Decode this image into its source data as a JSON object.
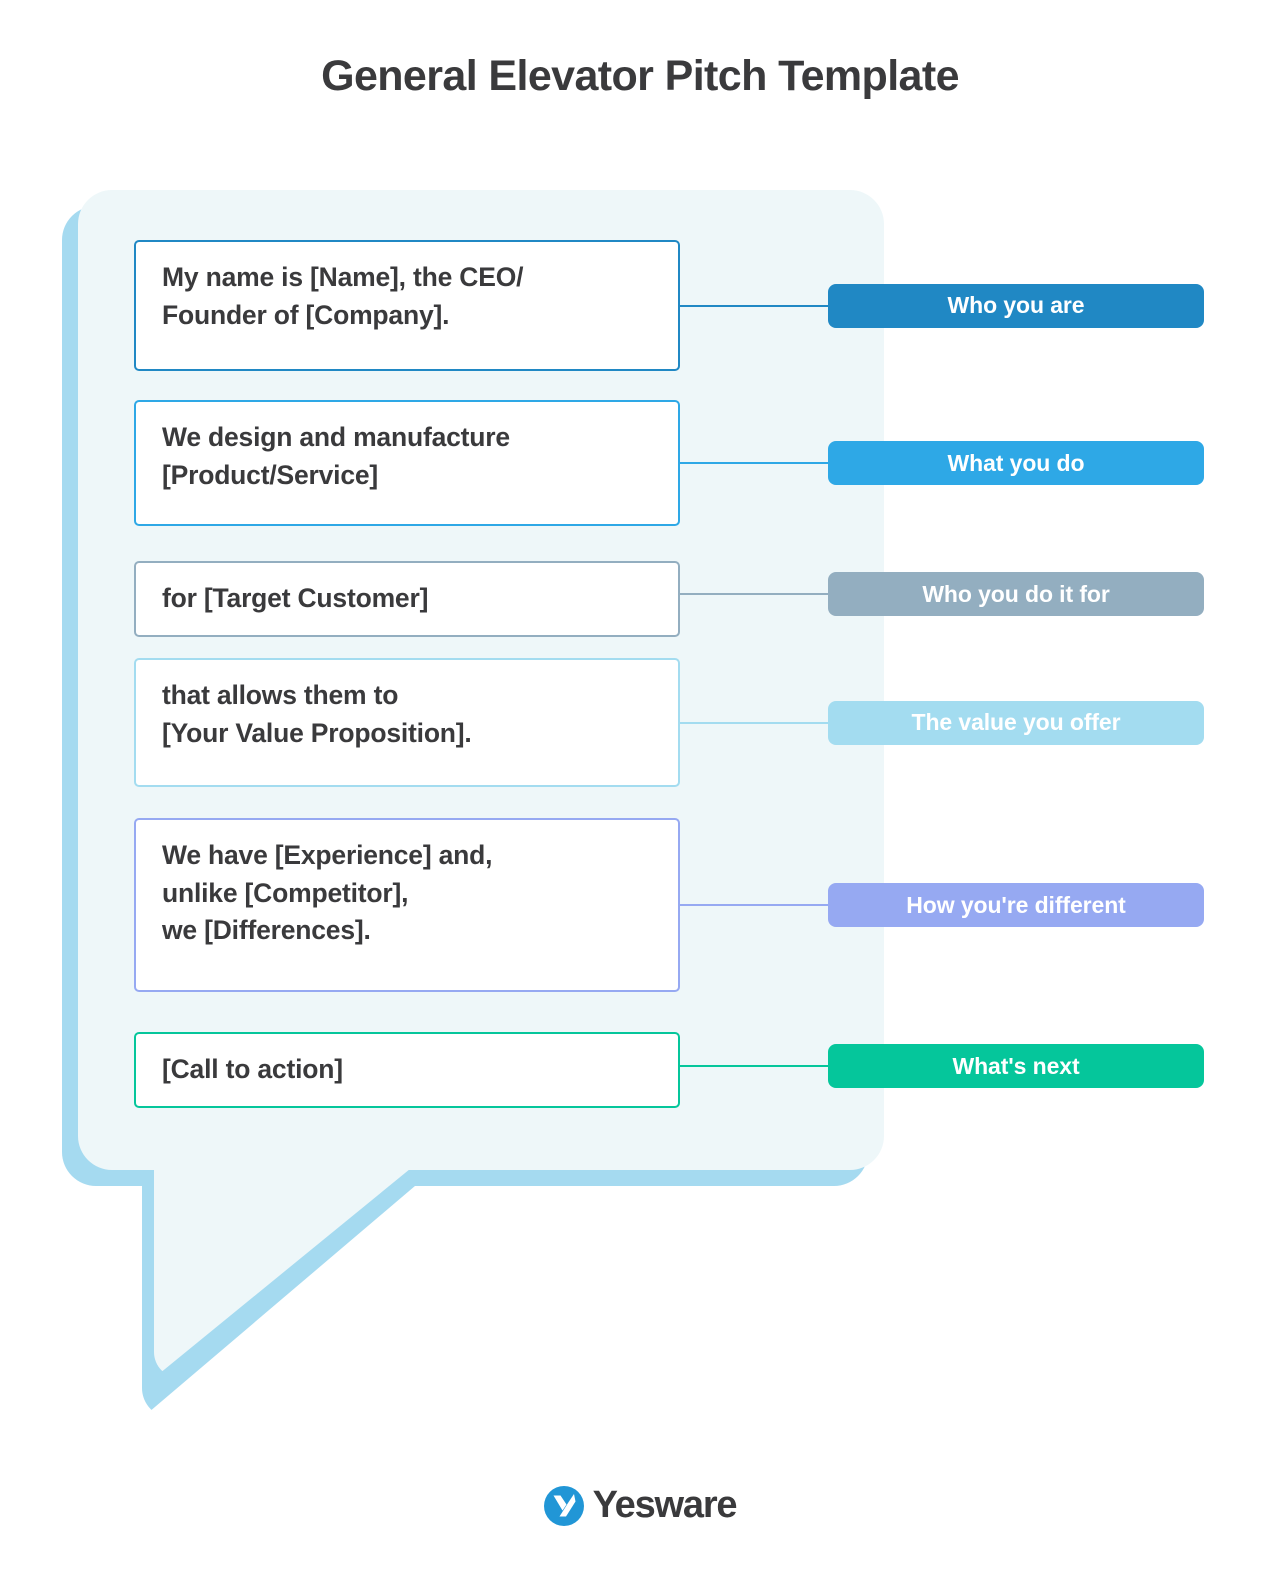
{
  "title": "General Elevator Pitch Template",
  "rows": [
    {
      "statement": "My name is [Name], the CEO/\nFounder of [Company].",
      "label": "Who you are",
      "color": "#2088c4"
    },
    {
      "statement": "We design and manufacture\n[Product/Service]",
      "label": "What you do",
      "color": "#2ea8e6"
    },
    {
      "statement": "for [Target Customer]",
      "label": "Who you do it for",
      "color": "#93aec0"
    },
    {
      "statement": "that allows them to\n[Your Value Proposition].",
      "label": "The value you offer",
      "color": "#a3dcf0"
    },
    {
      "statement": "We have [Experience] and,\nunlike [Competitor],\nwe [Differences].",
      "label": "How you're different",
      "color": "#96a9f2"
    },
    {
      "statement": "[Call to action]",
      "label": "What's next",
      "color": "#05c69b"
    }
  ],
  "footer": {
    "brand": "Yesware",
    "logo_icon": "yesware-y-logo-icon",
    "logo_color": "#2196d6"
  },
  "theme": {
    "bubble_fill": "#eef7f9",
    "bubble_outline": "#a5daf0",
    "text_color": "#3a3a3c",
    "page_background": "#ffffff"
  }
}
